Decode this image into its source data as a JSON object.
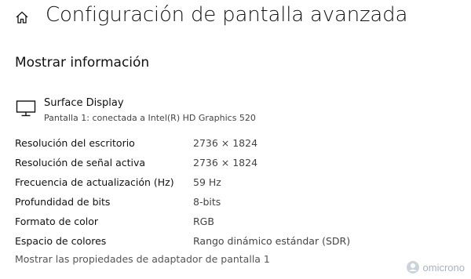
{
  "header": {
    "home_icon": "home-icon",
    "title": "Configuración de pantalla avanzada"
  },
  "section": {
    "title": "Mostrar información"
  },
  "display": {
    "icon": "monitor-icon",
    "name": "Surface Display",
    "connection": "Pantalla 1: conectada a Intel(R) HD Graphics 520"
  },
  "info_rows": [
    {
      "label": "Resolución del escritorio",
      "value": "2736 × 1824"
    },
    {
      "label": "Resolución de señal activa",
      "value": "2736 × 1824"
    },
    {
      "label": "Frecuencia de actualización (Hz)",
      "value": "59 Hz"
    },
    {
      "label": "Profundidad de bits",
      "value": "8-bits"
    },
    {
      "label": "Formato de color",
      "value": "RGB"
    },
    {
      "label": "Espacio de colores",
      "value": "Rango dinámico estándar (SDR)"
    }
  ],
  "adapter_link": "Mostrar las propiedades de adaptador de pantalla 1",
  "watermark": {
    "text": "omicrono"
  }
}
